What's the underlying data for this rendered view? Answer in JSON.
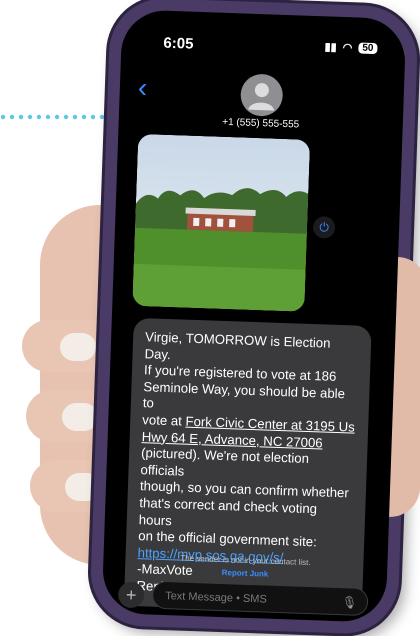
{
  "status_bar": {
    "time": "6:05",
    "battery": "50"
  },
  "header": {
    "contact": "+1 (555) 555-555"
  },
  "message": {
    "line1": "Virgie, TOMORROW is Election Day.",
    "line2": "If you're registered to vote at 186",
    "line3": "Seminole Way, you should be able to",
    "line4_pre": "vote at ",
    "line4_u": "Fork Civic Center at 3195 Us",
    "line5_u": "Hwy 64 E, Advance, NC 27006",
    "line6": "(pictured). We're not election officials",
    "line7": "though, so you can confirm whether",
    "line8": "that's correct and check voting hours",
    "line9": "on the official government site:",
    "link": "https://mvp.sos.ga.gov/s/",
    "sign": "-MaxVote",
    "stop": "Reply stop to end"
  },
  "footer": {
    "notice": "The sender is not in your contact list.",
    "report": "Report Junk",
    "placeholder": "Text Message • SMS"
  },
  "colors": {
    "accent": "#3a8dff",
    "bubble": "#3a3a3c",
    "phone_frame": "#4a3a66",
    "dots": "#5ac8e6"
  }
}
